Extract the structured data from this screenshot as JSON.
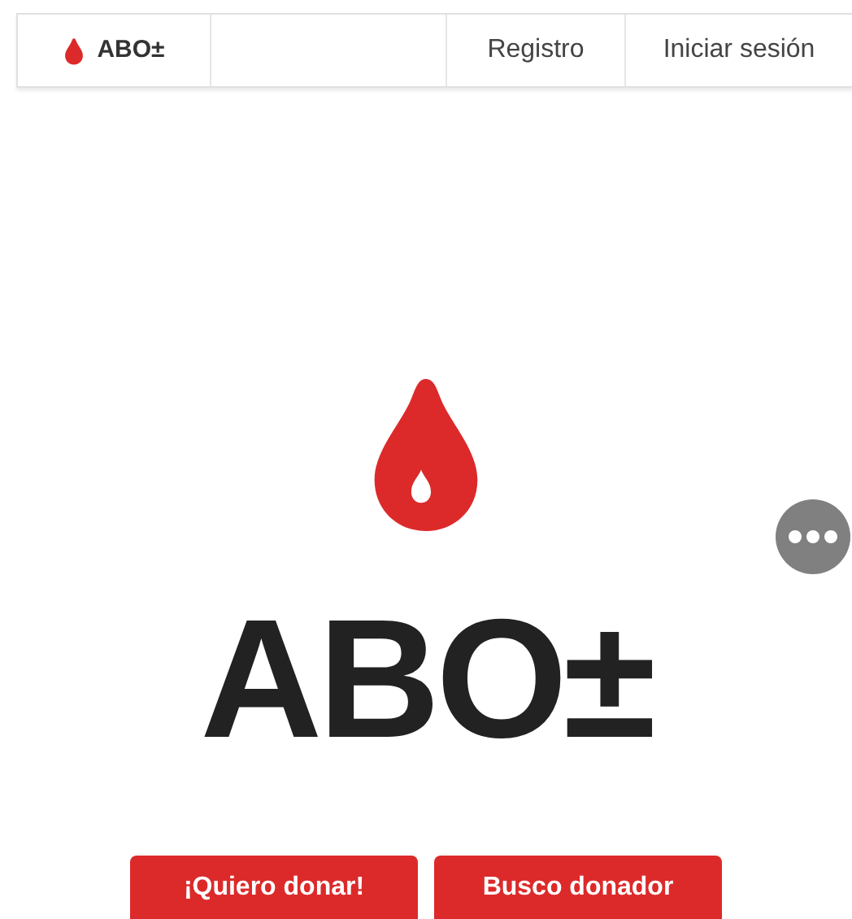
{
  "navbar": {
    "brand": "ABO±",
    "links": [
      "Registro",
      "Iniciar sesión"
    ]
  },
  "hero": {
    "title": "ABO±",
    "buttons": [
      "¡Quiero donar!",
      "Busco donador"
    ]
  }
}
